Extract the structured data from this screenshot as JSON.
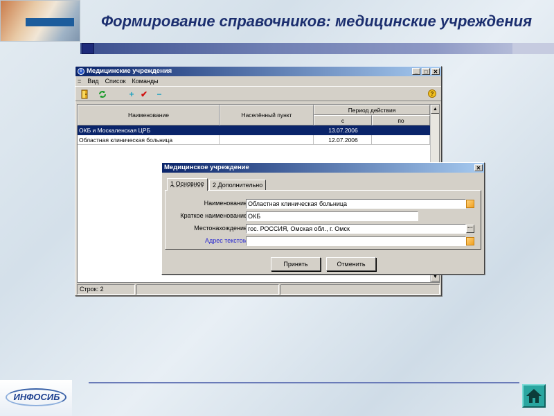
{
  "slide": {
    "title": "Формирование справочников: медицинские учреждения",
    "footer_logo": "ИНФОСИБ"
  },
  "colors": {
    "title_text": "#1c2f6f",
    "selection": "#0a246a",
    "caption_gradient_start": "#0a246a",
    "caption_gradient_end": "#a6caf0",
    "home_button": "#2aa6a0",
    "link_label": "#2a2ad0"
  },
  "main_window": {
    "title": "Медицинские учреждения",
    "menu": [
      "Вид",
      "Список",
      "Команды"
    ],
    "menu_icon": "=",
    "toolbar_icons": [
      "door-exit-icon",
      "refresh-icon",
      "add-icon",
      "check-icon",
      "remove-icon",
      "help-icon"
    ],
    "columns": {
      "name": "Наименование",
      "locality": "Населённый пункт",
      "period": "Период действия",
      "period_from": "с",
      "period_to": "по"
    },
    "rows": [
      {
        "name": "ОКБ и Москаленская ЦРБ",
        "locality": "",
        "from": "13.07.2006",
        "to": "",
        "selected": true
      },
      {
        "name": "Областная клиническая больница",
        "locality": "",
        "from": "12.07.2006",
        "to": "",
        "selected": false
      }
    ],
    "status": "Строк: 2"
  },
  "dialog": {
    "title": "Медицинское учреждение",
    "tabs": [
      "1 Основное",
      "2 Дополнительно"
    ],
    "active_tab": 0,
    "fields": [
      {
        "label": "Наименование",
        "value": "Областная клиническая больница",
        "button": "orange"
      },
      {
        "label": "Краткое наименование",
        "value": "ОКБ",
        "button": "none"
      },
      {
        "label": "Местонахождение",
        "value": "гос. РОССИЯ, Омская обл., г. Омск",
        "button": "dots"
      },
      {
        "label": "Адрес текстом",
        "value": "",
        "button": "orange"
      }
    ],
    "accept_label": "Принять",
    "cancel_label": "Отменить"
  }
}
